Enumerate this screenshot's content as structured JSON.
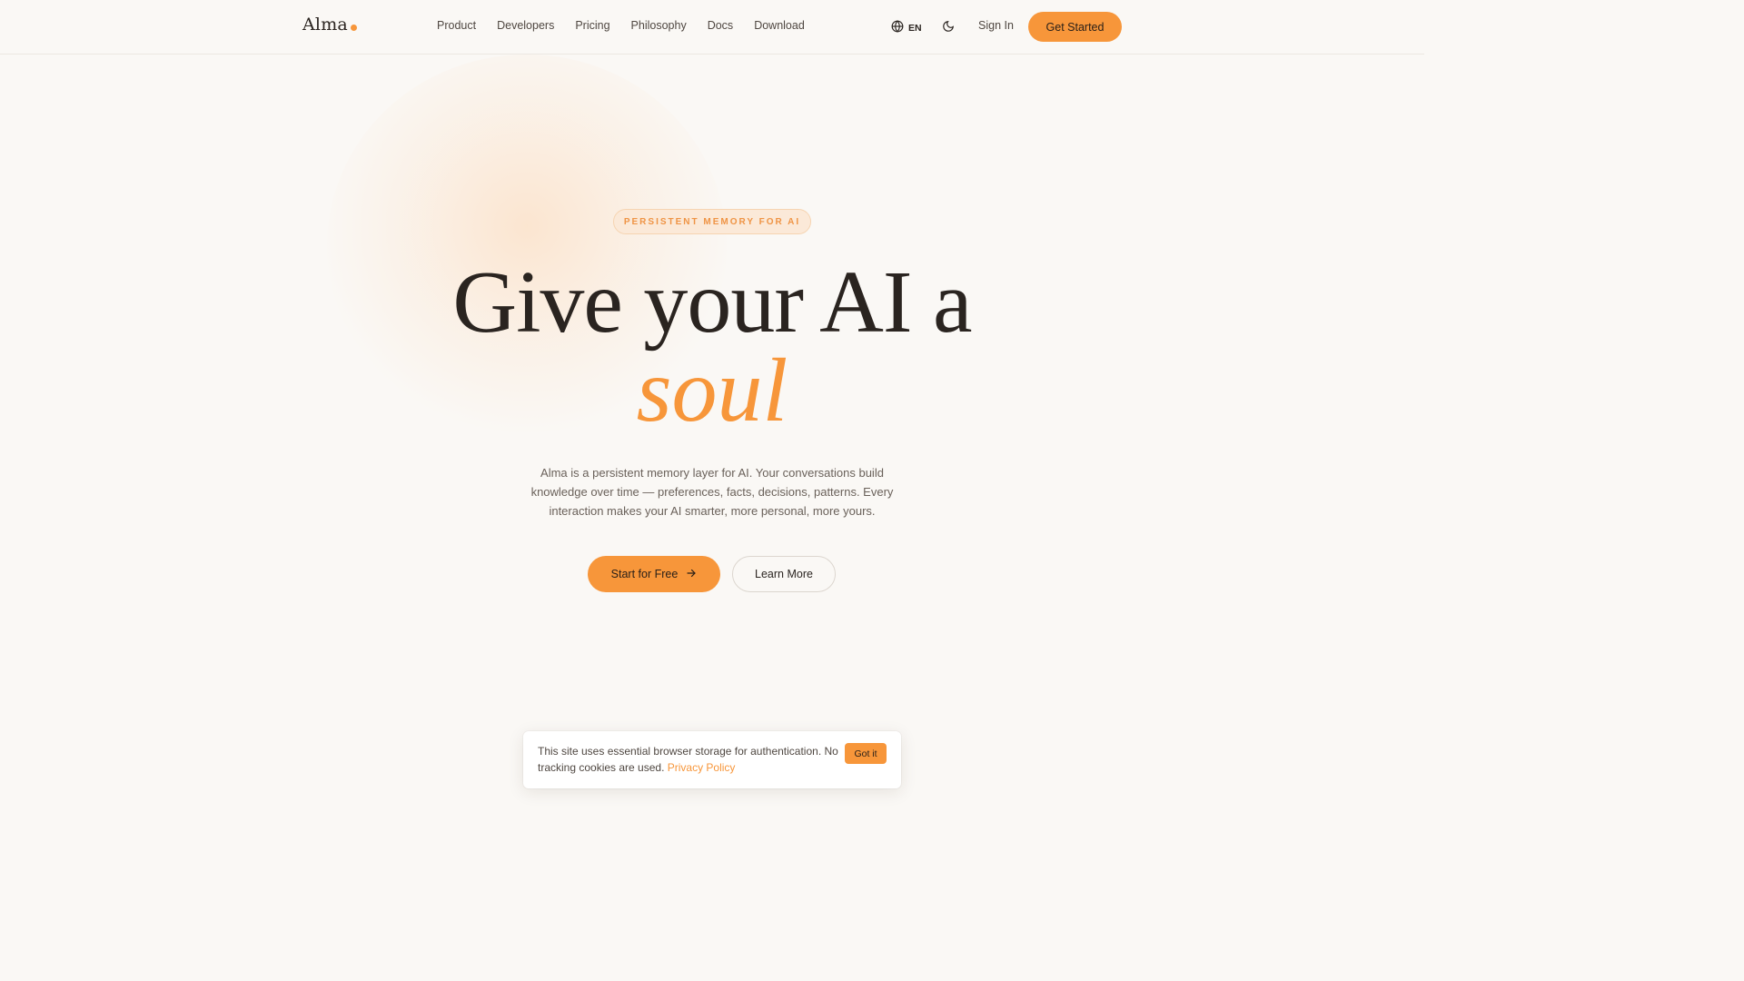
{
  "brand": {
    "name": "Alma",
    "accent_color": "#f7963a"
  },
  "nav": {
    "items": [
      {
        "label": "Product"
      },
      {
        "label": "Developers"
      },
      {
        "label": "Pricing"
      },
      {
        "label": "Philosophy"
      },
      {
        "label": "Docs"
      },
      {
        "label": "Download"
      }
    ],
    "language": "EN",
    "language_icon": "globe-icon",
    "theme_icon": "moon-icon",
    "sign_in": "Sign In",
    "get_started": "Get Started"
  },
  "hero": {
    "badge": "PERSISTENT MEMORY FOR AI",
    "headline": "Give your AI a",
    "headline_accent": "soul",
    "subtext": "Alma is a persistent memory layer for AI. Your conversations build knowledge over time — preferences, facts, decisions, patterns. Every interaction makes your AI smarter, more personal, more yours.",
    "primary_cta": "Start for Free",
    "primary_cta_icon": "arrow-right-icon",
    "secondary_cta": "Learn More"
  },
  "cookie_banner": {
    "text": "This site uses essential browser storage for authentication. No tracking cookies are used.",
    "link_text": "Privacy Policy",
    "button": "Got it"
  }
}
